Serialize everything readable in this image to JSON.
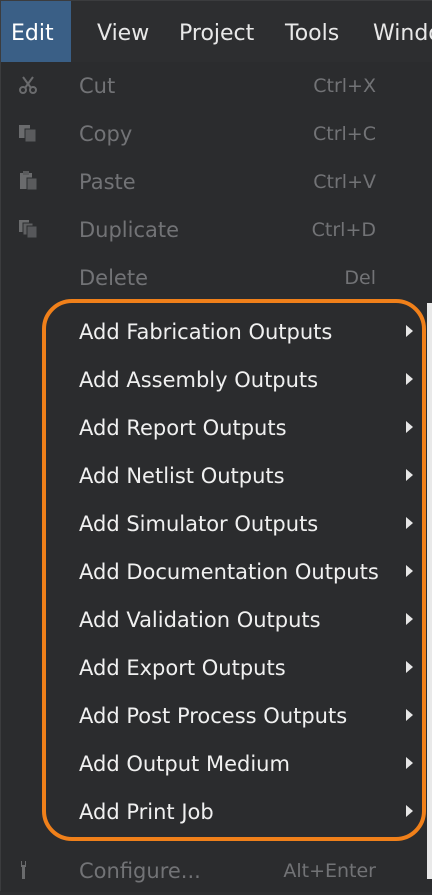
{
  "menubar": {
    "items": [
      {
        "label": "Edit",
        "active": true
      },
      {
        "label": "View",
        "active": false
      },
      {
        "label": "Project",
        "active": false
      },
      {
        "label": "Tools",
        "active": false
      },
      {
        "label": "Windo",
        "active": false
      }
    ]
  },
  "menu": {
    "items": [
      {
        "label": "Cut",
        "shortcut": "Ctrl+X",
        "enabled": false,
        "icon": "scissors-icon"
      },
      {
        "label": "Copy",
        "shortcut": "Ctrl+C",
        "enabled": false,
        "icon": "copy-icon"
      },
      {
        "label": "Paste",
        "shortcut": "Ctrl+V",
        "enabled": false,
        "icon": "paste-icon"
      },
      {
        "label": "Duplicate",
        "shortcut": "Ctrl+D",
        "enabled": false,
        "icon": "duplicate-icon"
      },
      {
        "label": "Delete",
        "shortcut": "Del",
        "enabled": false
      },
      {
        "label": "Add Fabrication Outputs",
        "enabled": true,
        "submenu": true
      },
      {
        "label": "Add Assembly Outputs",
        "enabled": true,
        "submenu": true
      },
      {
        "label": "Add Report Outputs",
        "enabled": true,
        "submenu": true
      },
      {
        "label": "Add Netlist Outputs",
        "enabled": true,
        "submenu": true
      },
      {
        "label": "Add Simulator Outputs",
        "enabled": true,
        "submenu": true
      },
      {
        "label": "Add Documentation Outputs",
        "enabled": true,
        "submenu": true
      },
      {
        "label": "Add Validation Outputs",
        "enabled": true,
        "submenu": true
      },
      {
        "label": "Add Export Outputs",
        "enabled": true,
        "submenu": true
      },
      {
        "label": "Add Post Process Outputs",
        "enabled": true,
        "submenu": true
      },
      {
        "label": "Add Output Medium",
        "enabled": true,
        "submenu": true
      },
      {
        "label": "Add Print Job",
        "enabled": true,
        "submenu": true
      },
      {
        "label": "Configure...",
        "shortcut": "Alt+Enter",
        "enabled": false,
        "icon": "wrench-icon"
      }
    ]
  },
  "colors": {
    "menu_bg": "#2b2c2e",
    "active_menu": "#3a5f86",
    "highlight_outline": "#f0801a",
    "disabled_text": "#727376",
    "enabled_text": "#f0f0f0"
  }
}
